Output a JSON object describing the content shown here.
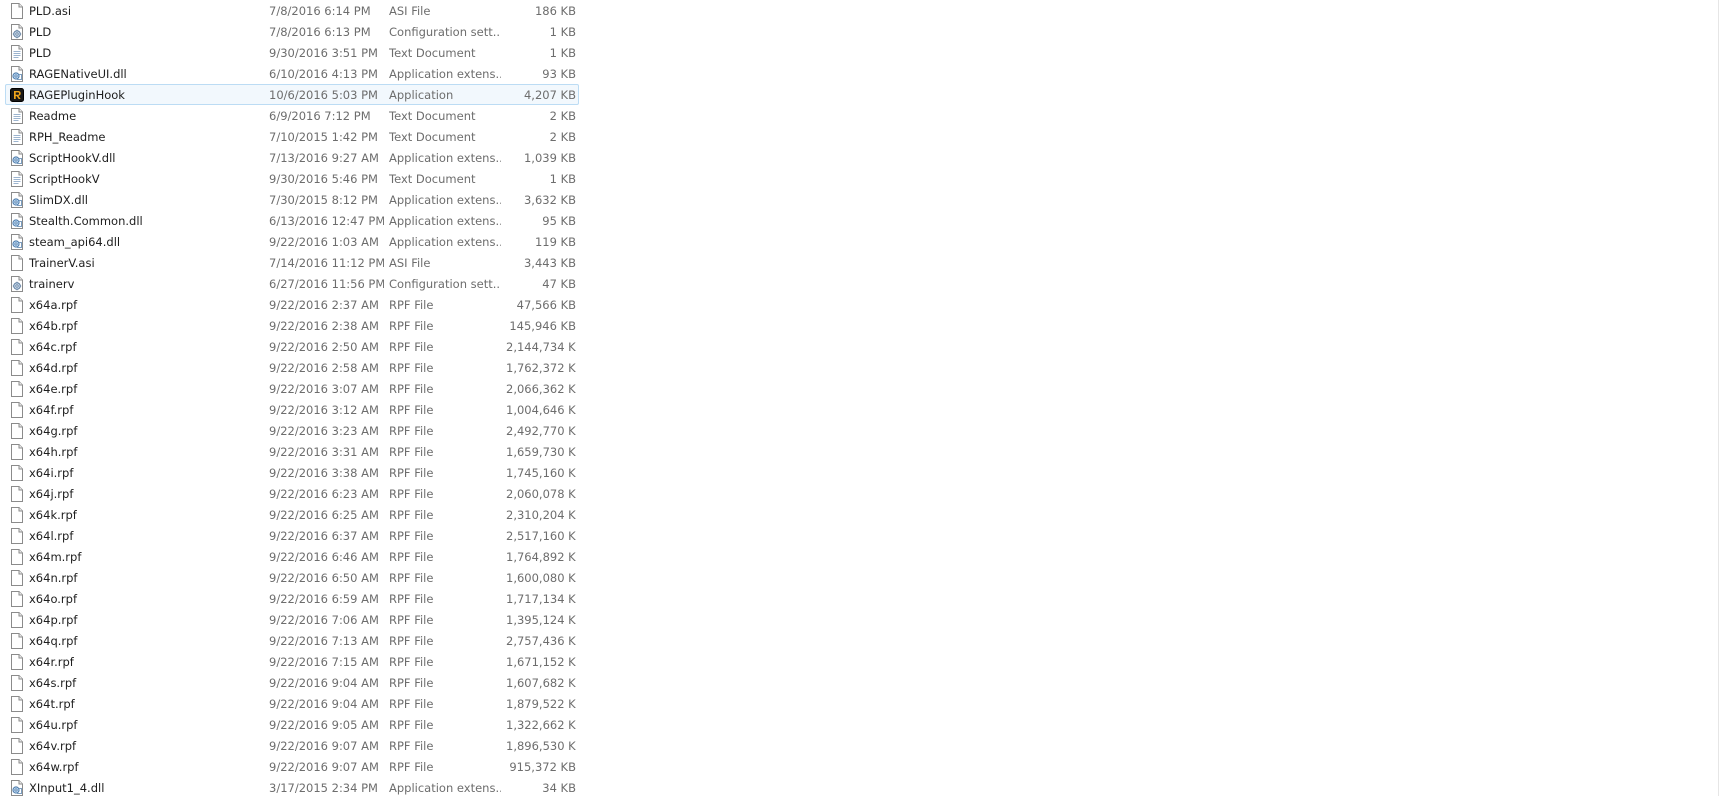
{
  "files": [
    {
      "name": "PLD.asi",
      "date": "7/8/2016 6:14 PM",
      "type": "ASI File",
      "size": "186 KB",
      "icon": "blank-file-icon"
    },
    {
      "name": "PLD",
      "date": "7/8/2016 6:13 PM",
      "type": "Configuration sett...",
      "size": "1 KB",
      "icon": "config-file-icon"
    },
    {
      "name": "PLD",
      "date": "9/30/2016 3:51 PM",
      "type": "Text Document",
      "size": "1 KB",
      "icon": "text-file-icon"
    },
    {
      "name": "RAGENativeUI.dll",
      "date": "6/10/2016 4:13 PM",
      "type": "Application extens...",
      "size": "93 KB",
      "icon": "dll-file-icon"
    },
    {
      "name": "RAGEPluginHook",
      "date": "10/6/2016 5:03 PM",
      "type": "Application",
      "size": "4,207 KB",
      "icon": "ragepluginhook-app-icon",
      "selected": true
    },
    {
      "name": "Readme",
      "date": "6/9/2016 7:12 PM",
      "type": "Text Document",
      "size": "2 KB",
      "icon": "text-file-icon"
    },
    {
      "name": "RPH_Readme",
      "date": "7/10/2015 1:42 PM",
      "type": "Text Document",
      "size": "2 KB",
      "icon": "text-file-icon"
    },
    {
      "name": "ScriptHookV.dll",
      "date": "7/13/2016 9:27 AM",
      "type": "Application extens...",
      "size": "1,039 KB",
      "icon": "dll-file-icon"
    },
    {
      "name": "ScriptHookV",
      "date": "9/30/2016 5:46 PM",
      "type": "Text Document",
      "size": "1 KB",
      "icon": "text-file-icon"
    },
    {
      "name": "SlimDX.dll",
      "date": "7/30/2015 8:12 PM",
      "type": "Application extens...",
      "size": "3,632 KB",
      "icon": "dll-file-icon"
    },
    {
      "name": "Stealth.Common.dll",
      "date": "6/13/2016 12:47 PM",
      "type": "Application extens...",
      "size": "95 KB",
      "icon": "dll-file-icon"
    },
    {
      "name": "steam_api64.dll",
      "date": "9/22/2016 1:03 AM",
      "type": "Application extens...",
      "size": "119 KB",
      "icon": "dll-file-icon"
    },
    {
      "name": "TrainerV.asi",
      "date": "7/14/2016 11:12 PM",
      "type": "ASI File",
      "size": "3,443 KB",
      "icon": "blank-file-icon"
    },
    {
      "name": "trainerv",
      "date": "6/27/2016 11:56 PM",
      "type": "Configuration sett...",
      "size": "47 KB",
      "icon": "config-file-icon"
    },
    {
      "name": "x64a.rpf",
      "date": "9/22/2016 2:37 AM",
      "type": "RPF File",
      "size": "47,566 KB",
      "icon": "blank-file-icon"
    },
    {
      "name": "x64b.rpf",
      "date": "9/22/2016 2:38 AM",
      "type": "RPF File",
      "size": "145,946 KB",
      "icon": "blank-file-icon"
    },
    {
      "name": "x64c.rpf",
      "date": "9/22/2016 2:50 AM",
      "type": "RPF File",
      "size": "2,144,734 KB",
      "icon": "blank-file-icon"
    },
    {
      "name": "x64d.rpf",
      "date": "9/22/2016 2:58 AM",
      "type": "RPF File",
      "size": "1,762,372 KB",
      "icon": "blank-file-icon"
    },
    {
      "name": "x64e.rpf",
      "date": "9/22/2016 3:07 AM",
      "type": "RPF File",
      "size": "2,066,362 KB",
      "icon": "blank-file-icon"
    },
    {
      "name": "x64f.rpf",
      "date": "9/22/2016 3:12 AM",
      "type": "RPF File",
      "size": "1,004,646 KB",
      "icon": "blank-file-icon"
    },
    {
      "name": "x64g.rpf",
      "date": "9/22/2016 3:23 AM",
      "type": "RPF File",
      "size": "2,492,770 KB",
      "icon": "blank-file-icon"
    },
    {
      "name": "x64h.rpf",
      "date": "9/22/2016 3:31 AM",
      "type": "RPF File",
      "size": "1,659,730 KB",
      "icon": "blank-file-icon"
    },
    {
      "name": "x64i.rpf",
      "date": "9/22/2016 3:38 AM",
      "type": "RPF File",
      "size": "1,745,160 KB",
      "icon": "blank-file-icon"
    },
    {
      "name": "x64j.rpf",
      "date": "9/22/2016 6:23 AM",
      "type": "RPF File",
      "size": "2,060,078 KB",
      "icon": "blank-file-icon"
    },
    {
      "name": "x64k.rpf",
      "date": "9/22/2016 6:25 AM",
      "type": "RPF File",
      "size": "2,310,204 KB",
      "icon": "blank-file-icon"
    },
    {
      "name": "x64l.rpf",
      "date": "9/22/2016 6:37 AM",
      "type": "RPF File",
      "size": "2,517,160 KB",
      "icon": "blank-file-icon"
    },
    {
      "name": "x64m.rpf",
      "date": "9/22/2016 6:46 AM",
      "type": "RPF File",
      "size": "1,764,892 KB",
      "icon": "blank-file-icon"
    },
    {
      "name": "x64n.rpf",
      "date": "9/22/2016 6:50 AM",
      "type": "RPF File",
      "size": "1,600,080 KB",
      "icon": "blank-file-icon"
    },
    {
      "name": "x64o.rpf",
      "date": "9/22/2016 6:59 AM",
      "type": "RPF File",
      "size": "1,717,134 KB",
      "icon": "blank-file-icon"
    },
    {
      "name": "x64p.rpf",
      "date": "9/22/2016 7:06 AM",
      "type": "RPF File",
      "size": "1,395,124 KB",
      "icon": "blank-file-icon"
    },
    {
      "name": "x64q.rpf",
      "date": "9/22/2016 7:13 AM",
      "type": "RPF File",
      "size": "2,757,436 KB",
      "icon": "blank-file-icon"
    },
    {
      "name": "x64r.rpf",
      "date": "9/22/2016 7:15 AM",
      "type": "RPF File",
      "size": "1,671,152 KB",
      "icon": "blank-file-icon"
    },
    {
      "name": "x64s.rpf",
      "date": "9/22/2016 9:04 AM",
      "type": "RPF File",
      "size": "1,607,682 KB",
      "icon": "blank-file-icon"
    },
    {
      "name": "x64t.rpf",
      "date": "9/22/2016 9:04 AM",
      "type": "RPF File",
      "size": "1,879,522 KB",
      "icon": "blank-file-icon"
    },
    {
      "name": "x64u.rpf",
      "date": "9/22/2016 9:05 AM",
      "type": "RPF File",
      "size": "1,322,662 KB",
      "icon": "blank-file-icon"
    },
    {
      "name": "x64v.rpf",
      "date": "9/22/2016 9:07 AM",
      "type": "RPF File",
      "size": "1,896,530 KB",
      "icon": "blank-file-icon"
    },
    {
      "name": "x64w.rpf",
      "date": "9/22/2016 9:07 AM",
      "type": "RPF File",
      "size": "915,372 KB",
      "icon": "blank-file-icon"
    },
    {
      "name": "XInput1_4.dll",
      "date": "3/17/2015 2:34 PM",
      "type": "Application extens...",
      "size": "34 KB",
      "icon": "dll-file-icon"
    }
  ],
  "colors": {
    "selection_background": "#f2f8fd",
    "selection_border": "#bcdcf4",
    "name_text": "#1e1e1e",
    "detail_text": "#6d6d6d"
  }
}
